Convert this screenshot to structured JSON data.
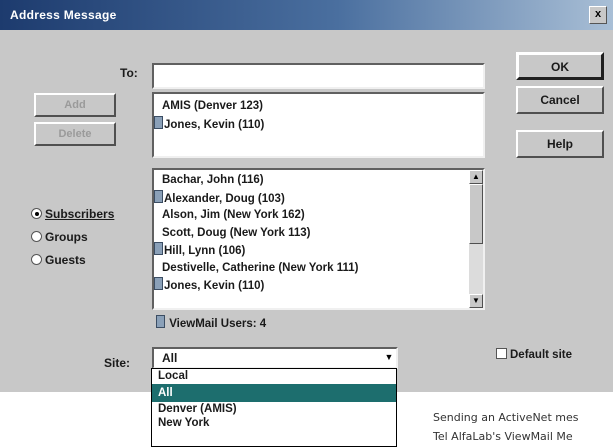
{
  "window": {
    "title": "Address Message",
    "close_label": "x"
  },
  "to": {
    "label": "To:",
    "value": ""
  },
  "buttons": {
    "ok": "OK",
    "cancel": "Cancel",
    "help": "Help",
    "add": "Add",
    "delete": "Delete"
  },
  "recipients": [
    {
      "name": "AMIS (Denver 123)",
      "icon": false
    },
    {
      "name": "Jones, Kevin (110)",
      "icon": true
    }
  ],
  "radio": {
    "subscribers": "Subscribers",
    "groups": "Groups",
    "guests": "Guests",
    "selected": "subscribers"
  },
  "directory": [
    {
      "name": "Bachar, John (116)",
      "icon": false
    },
    {
      "name": "Alexander, Doug (103)",
      "icon": true
    },
    {
      "name": "Alson, Jim (New York 162)",
      "icon": false
    },
    {
      "name": "Scott, Doug (New York 113)",
      "icon": false
    },
    {
      "name": "Hill, Lynn (106)",
      "icon": true
    },
    {
      "name": "Destivelle, Catherine (New York 111)",
      "icon": false
    },
    {
      "name": "Jones, Kevin (110)",
      "icon": true
    }
  ],
  "viewmail_users": "ViewMail Users: 4",
  "site": {
    "label": "Site:",
    "value": "All",
    "default_label": "Default site",
    "options": [
      "Local",
      "All",
      "Denver (AMIS)",
      "New York"
    ],
    "selected_index": 1
  },
  "background_text": {
    "line1": "Sending an ActiveNet mes",
    "line2": "Tel AlfaLab's ViewMail Me"
  },
  "icons": {
    "user": "mailbox-icon",
    "scroll_up": "arrow-up-icon",
    "scroll_down": "arrow-down-icon",
    "dropdown": "chevron-down-icon"
  }
}
